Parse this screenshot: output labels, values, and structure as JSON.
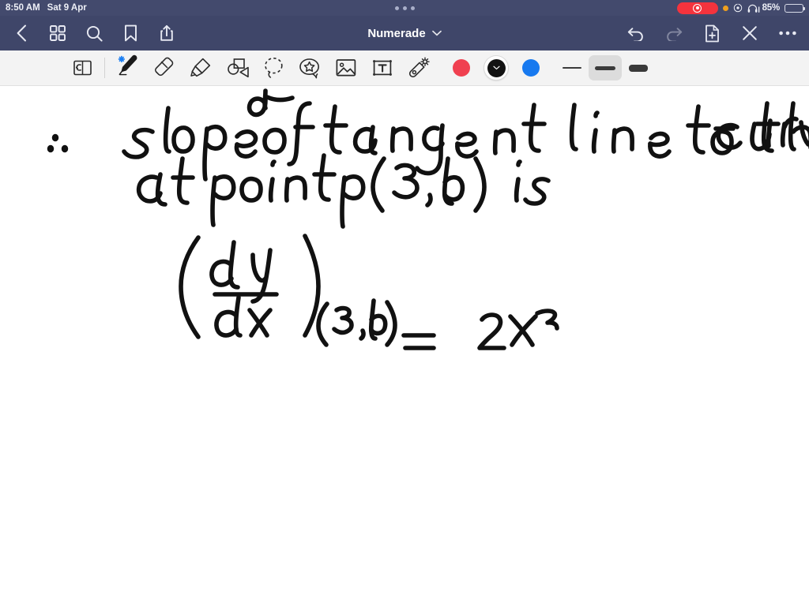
{
  "status_bar": {
    "time": "8:50 AM",
    "date": "Sat 9 Apr",
    "battery_percent": "85%",
    "battery_level": 85,
    "icons": [
      "screen-recording-pill",
      "microphone-in-use-dot",
      "control-center-icon",
      "headphones-icon",
      "battery-icon"
    ],
    "background": "#434a6d"
  },
  "nav_bar": {
    "title": "Numerade",
    "background": "#3f4669",
    "left_buttons": [
      {
        "name": "back-button",
        "icon": "chevron-left-icon"
      },
      {
        "name": "thumbnails-button",
        "icon": "grid-icon"
      },
      {
        "name": "search-button",
        "icon": "search-icon"
      },
      {
        "name": "bookmark-button",
        "icon": "bookmark-icon"
      },
      {
        "name": "share-button",
        "icon": "share-icon"
      }
    ],
    "right_buttons": [
      {
        "name": "undo-button",
        "icon": "undo-icon",
        "enabled": true
      },
      {
        "name": "redo-button",
        "icon": "redo-icon",
        "enabled": false
      },
      {
        "name": "add-page-button",
        "icon": "document-plus-icon",
        "enabled": true
      },
      {
        "name": "close-button",
        "icon": "close-x-icon",
        "enabled": true
      },
      {
        "name": "more-button",
        "icon": "ellipsis-icon",
        "enabled": true
      }
    ]
  },
  "toolbar": {
    "background": "#f3f3f3",
    "tools": [
      {
        "name": "page-flip-tool",
        "icon": "page-flip-icon",
        "selected": false
      },
      {
        "name": "pen-tool",
        "icon": "pen-icon",
        "selected": true,
        "badge": "bluetooth-connected"
      },
      {
        "name": "eraser-tool",
        "icon": "eraser-icon",
        "selected": false
      },
      {
        "name": "highlighter-tool",
        "icon": "highlighter-icon",
        "selected": false
      },
      {
        "name": "shapes-tool",
        "icon": "shapes-icon",
        "selected": false
      },
      {
        "name": "lasso-tool",
        "icon": "lasso-icon",
        "selected": false
      },
      {
        "name": "sticker-tool",
        "icon": "sticker-star-icon",
        "selected": false
      },
      {
        "name": "image-tool",
        "icon": "image-icon",
        "selected": false
      },
      {
        "name": "text-tool",
        "icon": "text-box-icon",
        "selected": false
      },
      {
        "name": "laser-tool",
        "icon": "magic-wand-icon",
        "selected": false
      }
    ],
    "colors": [
      {
        "name": "color-red",
        "hex": "#f04050",
        "selected": false
      },
      {
        "name": "color-black",
        "hex": "#121212",
        "selected": true
      },
      {
        "name": "color-blue",
        "hex": "#1779ef",
        "selected": false
      }
    ],
    "stroke_widths": [
      {
        "name": "stroke-thin",
        "thickness": 2,
        "length": 24,
        "selected": false
      },
      {
        "name": "stroke-medium",
        "thickness": 5,
        "length": 26,
        "selected": true
      },
      {
        "name": "stroke-thick",
        "thickness": 9,
        "length": 24,
        "selected": false
      }
    ]
  },
  "canvas": {
    "background": "#ffffff",
    "ink_color": "#111111",
    "handwriting": {
      "clipped_fragment_top": "dx",
      "line_1": "∴ slope of tangent line to the curve",
      "line_2": "at point P(3, b) is",
      "line_3_lhs_numerator": "dy",
      "line_3_lhs_denominator": "dx",
      "line_3_subscript": "(3,b)",
      "line_3_equals": "=",
      "line_3_rhs": "2×3"
    }
  }
}
